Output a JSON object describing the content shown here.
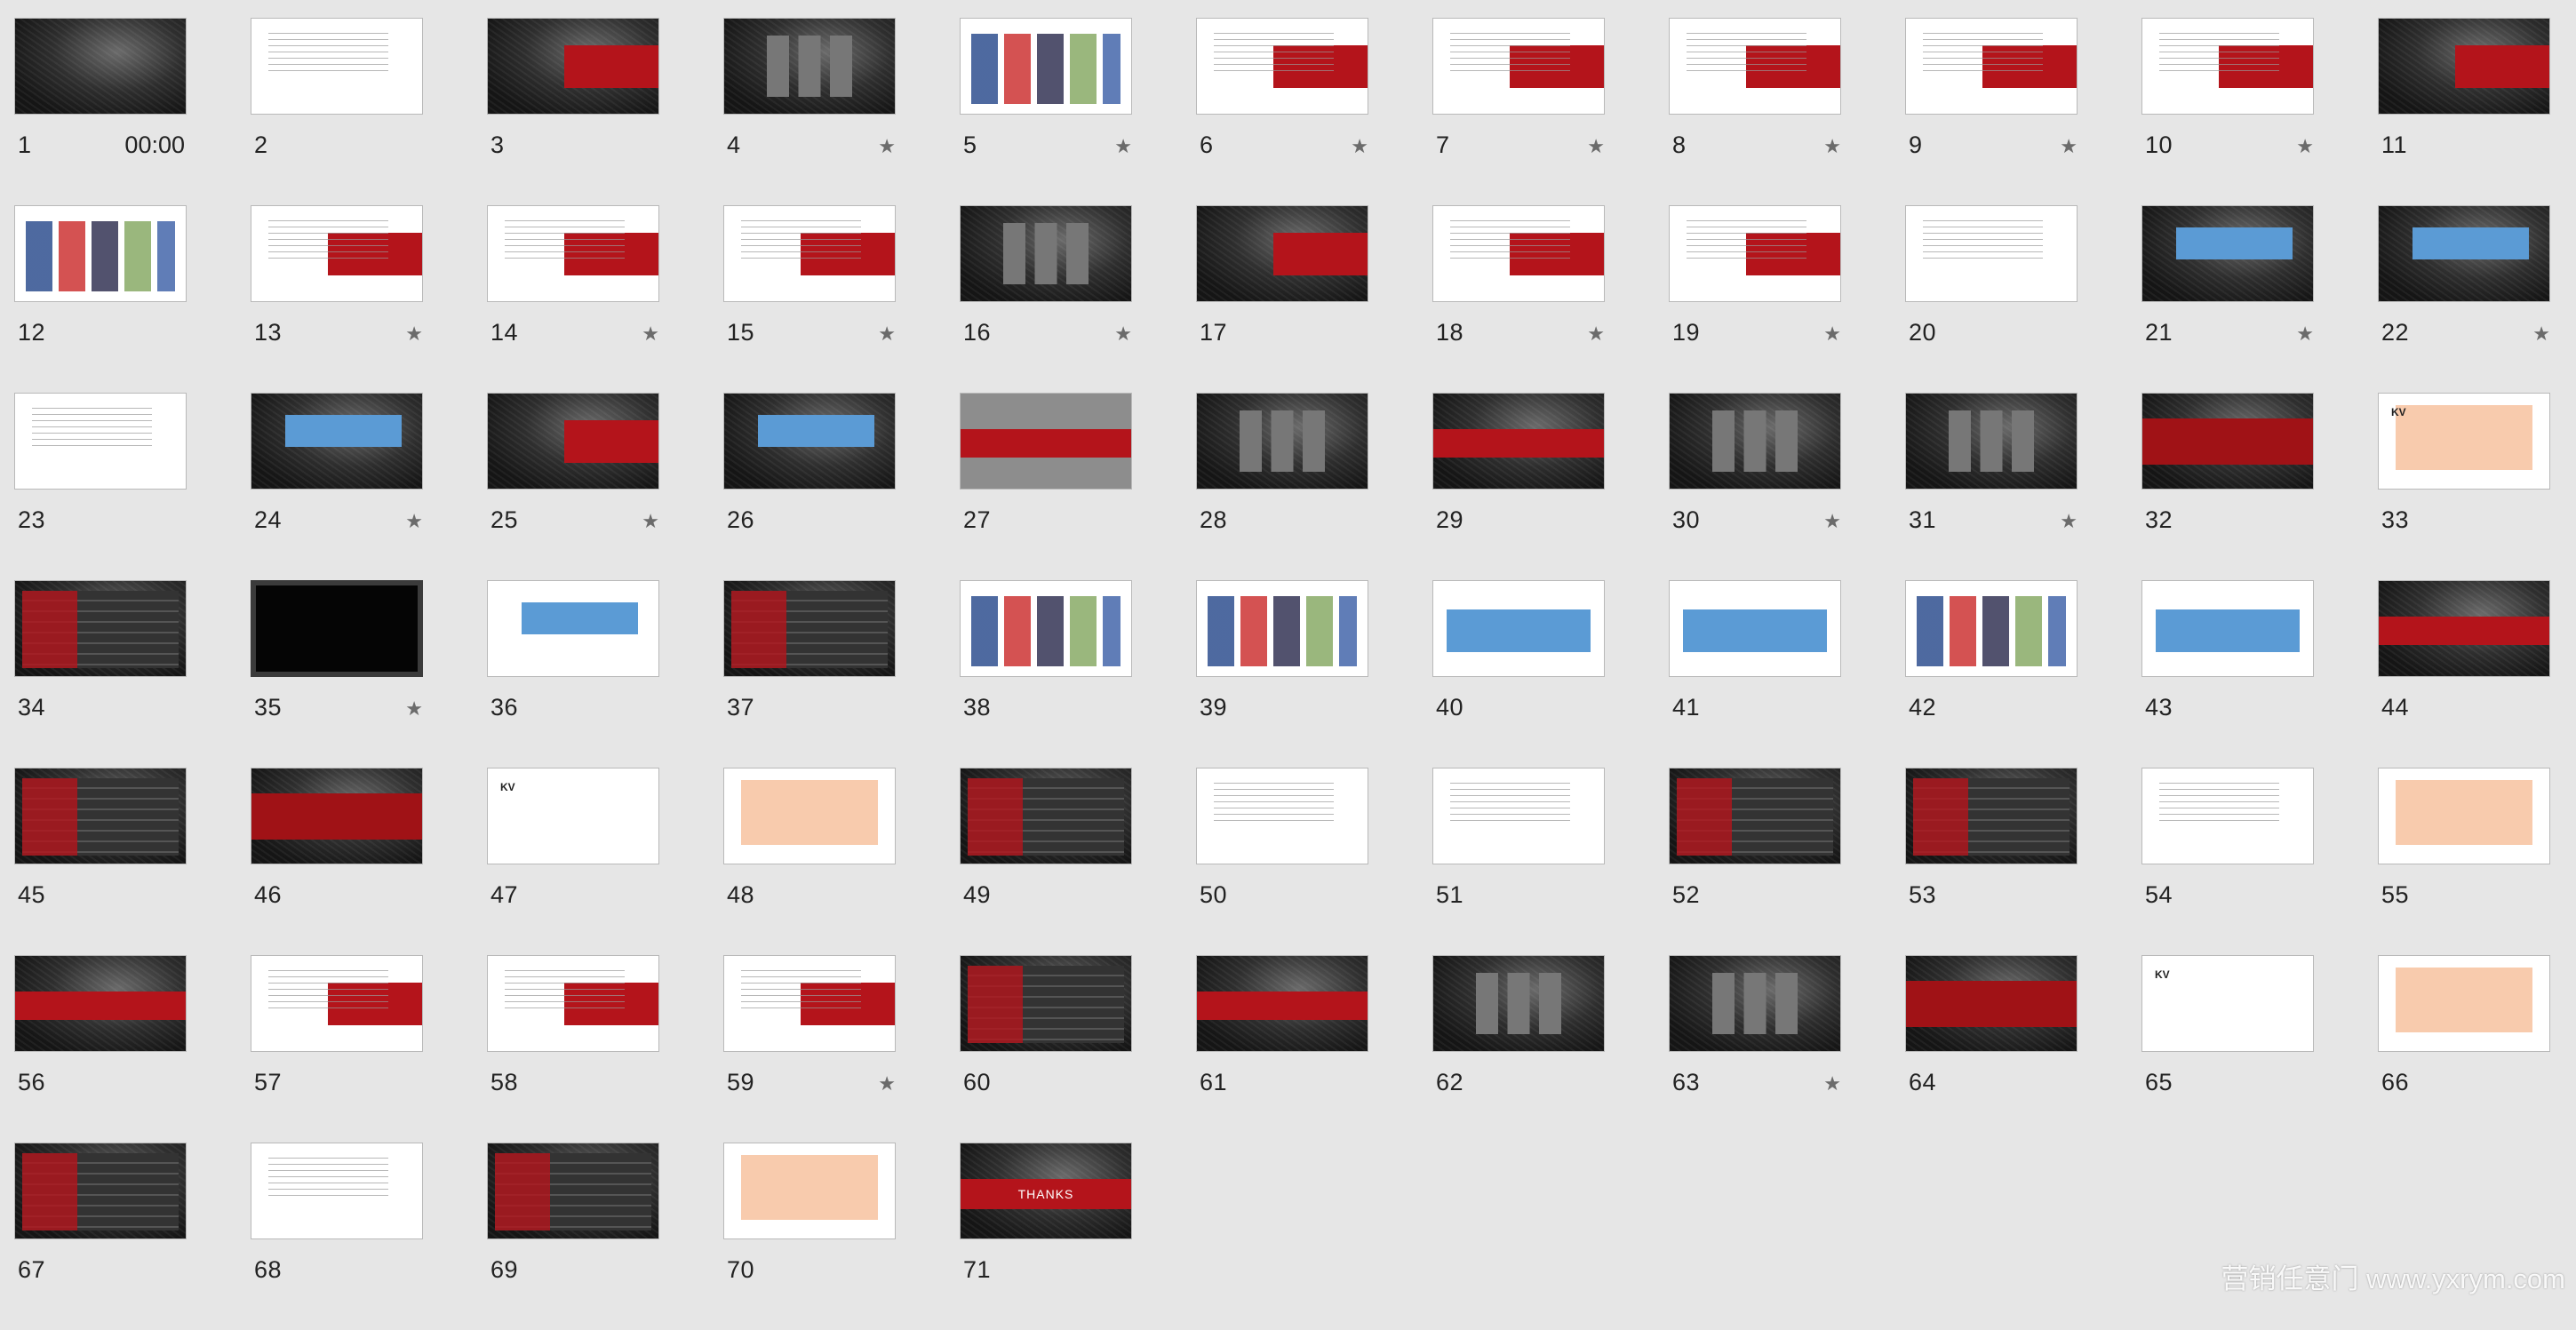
{
  "slides": [
    {
      "number": "1",
      "time": "00:00",
      "star": "",
      "style": "dark"
    },
    {
      "number": "2",
      "time": "",
      "star": "",
      "style": "white-lines"
    },
    {
      "number": "3",
      "time": "",
      "star": "",
      "style": "dark-red-right"
    },
    {
      "number": "4",
      "time": "",
      "star": "★",
      "style": "dark-boxes"
    },
    {
      "number": "5",
      "time": "",
      "star": "★",
      "style": "white-collage"
    },
    {
      "number": "6",
      "time": "",
      "star": "★",
      "style": "white-red-right"
    },
    {
      "number": "7",
      "time": "",
      "star": "★",
      "style": "white-red-right"
    },
    {
      "number": "8",
      "time": "",
      "star": "★",
      "style": "white-red-right"
    },
    {
      "number": "9",
      "time": "",
      "star": "★",
      "style": "white-red-right"
    },
    {
      "number": "10",
      "time": "",
      "star": "★",
      "style": "white-red-right"
    },
    {
      "number": "11",
      "time": "",
      "star": "",
      "style": "dark-red-right"
    },
    {
      "number": "12",
      "time": "",
      "star": "",
      "style": "white-collage"
    },
    {
      "number": "13",
      "time": "",
      "star": "★",
      "style": "white-red-right"
    },
    {
      "number": "14",
      "time": "",
      "star": "★",
      "style": "white-red-right"
    },
    {
      "number": "15",
      "time": "",
      "star": "★",
      "style": "white-red-right"
    },
    {
      "number": "16",
      "time": "",
      "star": "★",
      "style": "dark-boxes"
    },
    {
      "number": "17",
      "time": "",
      "star": "",
      "style": "dark-red-right"
    },
    {
      "number": "18",
      "time": "",
      "star": "★",
      "style": "white-red-right"
    },
    {
      "number": "19",
      "time": "",
      "star": "★",
      "style": "white-red-right"
    },
    {
      "number": "20",
      "time": "",
      "star": "",
      "style": "white-lines"
    },
    {
      "number": "21",
      "time": "",
      "star": "★",
      "style": "dark-blue"
    },
    {
      "number": "22",
      "time": "",
      "star": "★",
      "style": "dark-blue"
    },
    {
      "number": "23",
      "time": "",
      "star": "",
      "style": "white-lines"
    },
    {
      "number": "24",
      "time": "",
      "star": "★",
      "style": "dark-blue"
    },
    {
      "number": "25",
      "time": "",
      "star": "★",
      "style": "dark-red-right"
    },
    {
      "number": "26",
      "time": "",
      "star": "",
      "style": "dark-blue"
    },
    {
      "number": "27",
      "time": "",
      "star": "",
      "style": "gray-red"
    },
    {
      "number": "28",
      "time": "",
      "star": "",
      "style": "dark-boxes"
    },
    {
      "number": "29",
      "time": "",
      "star": "",
      "style": "dark-red"
    },
    {
      "number": "30",
      "time": "",
      "star": "★",
      "style": "dark-boxes"
    },
    {
      "number": "31",
      "time": "",
      "star": "★",
      "style": "dark-boxes"
    },
    {
      "number": "32",
      "time": "",
      "star": "",
      "style": "dark-red-half"
    },
    {
      "number": "33",
      "time": "",
      "star": "",
      "style": "kv-orange"
    },
    {
      "number": "34",
      "time": "",
      "star": "",
      "style": "panel-dark"
    },
    {
      "number": "35",
      "time": "",
      "star": "★",
      "style": "black"
    },
    {
      "number": "36",
      "time": "",
      "star": "",
      "style": "white-blue"
    },
    {
      "number": "37",
      "time": "",
      "star": "",
      "style": "panel-dark"
    },
    {
      "number": "38",
      "time": "",
      "star": "",
      "style": "white-collage"
    },
    {
      "number": "39",
      "time": "",
      "star": "",
      "style": "white-collage"
    },
    {
      "number": "40",
      "time": "",
      "star": "",
      "style": "white-blue-wide"
    },
    {
      "number": "41",
      "time": "",
      "star": "",
      "style": "white-blue-wide"
    },
    {
      "number": "42",
      "time": "",
      "star": "",
      "style": "white-collage"
    },
    {
      "number": "43",
      "time": "",
      "star": "",
      "style": "white-blue-wide"
    },
    {
      "number": "44",
      "time": "",
      "star": "",
      "style": "dark-red"
    },
    {
      "number": "45",
      "time": "",
      "star": "",
      "style": "panel-dark"
    },
    {
      "number": "46",
      "time": "",
      "star": "",
      "style": "dark-red-half"
    },
    {
      "number": "47",
      "time": "",
      "star": "",
      "style": "kv"
    },
    {
      "number": "48",
      "time": "",
      "star": "",
      "style": "white-orange"
    },
    {
      "number": "49",
      "time": "",
      "star": "",
      "style": "panel-dark"
    },
    {
      "number": "50",
      "time": "",
      "star": "",
      "style": "white-lines"
    },
    {
      "number": "51",
      "time": "",
      "star": "",
      "style": "white-lines"
    },
    {
      "number": "52",
      "time": "",
      "star": "",
      "style": "panel-dark"
    },
    {
      "number": "53",
      "time": "",
      "star": "",
      "style": "panel-dark"
    },
    {
      "number": "54",
      "time": "",
      "star": "",
      "style": "white-lines"
    },
    {
      "number": "55",
      "time": "",
      "star": "",
      "style": "white-orange"
    },
    {
      "number": "56",
      "time": "",
      "star": "",
      "style": "dark-red"
    },
    {
      "number": "57",
      "time": "",
      "star": "",
      "style": "white-red-right"
    },
    {
      "number": "58",
      "time": "",
      "star": "",
      "style": "white-red-right"
    },
    {
      "number": "59",
      "time": "",
      "star": "★",
      "style": "white-red-right"
    },
    {
      "number": "60",
      "time": "",
      "star": "",
      "style": "panel-dark"
    },
    {
      "number": "61",
      "time": "",
      "star": "",
      "style": "dark-red"
    },
    {
      "number": "62",
      "time": "",
      "star": "",
      "style": "dark-boxes"
    },
    {
      "number": "63",
      "time": "",
      "star": "★",
      "style": "dark-boxes"
    },
    {
      "number": "64",
      "time": "",
      "star": "",
      "style": "dark-red-half"
    },
    {
      "number": "65",
      "time": "",
      "star": "",
      "style": "kv"
    },
    {
      "number": "66",
      "time": "",
      "star": "",
      "style": "white-orange"
    },
    {
      "number": "67",
      "time": "",
      "star": "",
      "style": "panel-dark"
    },
    {
      "number": "68",
      "time": "",
      "star": "",
      "style": "white-lines"
    },
    {
      "number": "69",
      "time": "",
      "star": "",
      "style": "panel-dark"
    },
    {
      "number": "70",
      "time": "",
      "star": "",
      "style": "white-orange"
    },
    {
      "number": "71",
      "time": "",
      "star": "",
      "style": "thanks"
    }
  ],
  "thumb_text": {
    "kv": "KV",
    "thanks": "THANKS"
  },
  "watermark": "营销任意门 www.yxrym.com",
  "colors": {
    "background": "#e6e6e6",
    "brand_red": "#b4141b",
    "blue": "#5b9bd5",
    "orange": "#f8cbad"
  }
}
